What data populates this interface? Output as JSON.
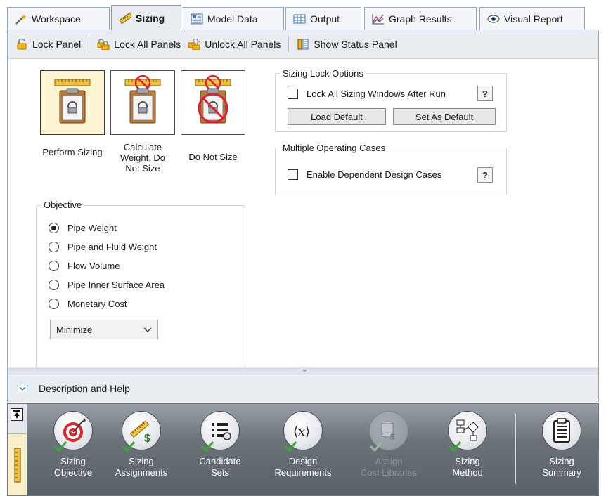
{
  "tabs": [
    {
      "label": "Workspace",
      "icon": "wand-icon"
    },
    {
      "label": "Sizing",
      "icon": "ruler-icon"
    },
    {
      "label": "Model Data",
      "icon": "model-data-icon"
    },
    {
      "label": "Output",
      "icon": "table-icon"
    },
    {
      "label": "Graph Results",
      "icon": "graph-icon"
    },
    {
      "label": "Visual Report",
      "icon": "eye-icon"
    }
  ],
  "toolbar": {
    "lock_panel": "Lock Panel",
    "lock_all": "Lock All Panels",
    "unlock_all": "Unlock All Panels",
    "show_status": "Show Status Panel"
  },
  "sizing_modes": [
    {
      "label": "Perform Sizing",
      "selected": true
    },
    {
      "label": "Calculate Weight, Do Not Size",
      "selected": false
    },
    {
      "label": "Do Not Size",
      "selected": false
    }
  ],
  "objective": {
    "title": "Objective",
    "options": [
      "Pipe Weight",
      "Pipe and Fluid Weight",
      "Flow Volume",
      "Pipe Inner Surface Area",
      "Monetary Cost"
    ],
    "selected": "Pipe Weight",
    "direction": "Minimize"
  },
  "lock_options": {
    "title": "Sizing Lock Options",
    "checkbox": "Lock All Sizing Windows After Run",
    "help": "?",
    "load_default": "Load Default",
    "set_default": "Set As Default"
  },
  "multi_cases": {
    "title": "Multiple Operating Cases",
    "checkbox": "Enable Dependent Design Cases",
    "help": "?"
  },
  "description_help": "Description and Help",
  "quick_access": [
    {
      "label1": "Sizing",
      "label2": "Objective",
      "icon": "target-icon",
      "checked": true,
      "enabled": true
    },
    {
      "label1": "Sizing",
      "label2": "Assignments",
      "icon": "ruler-dollar-icon",
      "checked": true,
      "enabled": true
    },
    {
      "label1": "Candidate",
      "label2": "Sets",
      "icon": "list-icon",
      "checked": true,
      "enabled": true
    },
    {
      "label1": "Design",
      "label2": "Requirements",
      "icon": "function-x-icon",
      "checked": true,
      "enabled": true
    },
    {
      "label1": "Assign",
      "label2": "Cost Libraries",
      "icon": "cost-library-icon",
      "checked": true,
      "enabled": false
    },
    {
      "label1": "Sizing",
      "label2": "Method",
      "icon": "flowchart-icon",
      "checked": true,
      "enabled": true
    },
    {
      "label1": "Sizing",
      "label2": "Summary",
      "icon": "clipboard-icon",
      "checked": false,
      "enabled": true
    }
  ],
  "colors": {
    "selected_bg": "#fdf5d2",
    "check_green": "#3aa63a",
    "target_red": "#d8242a"
  }
}
